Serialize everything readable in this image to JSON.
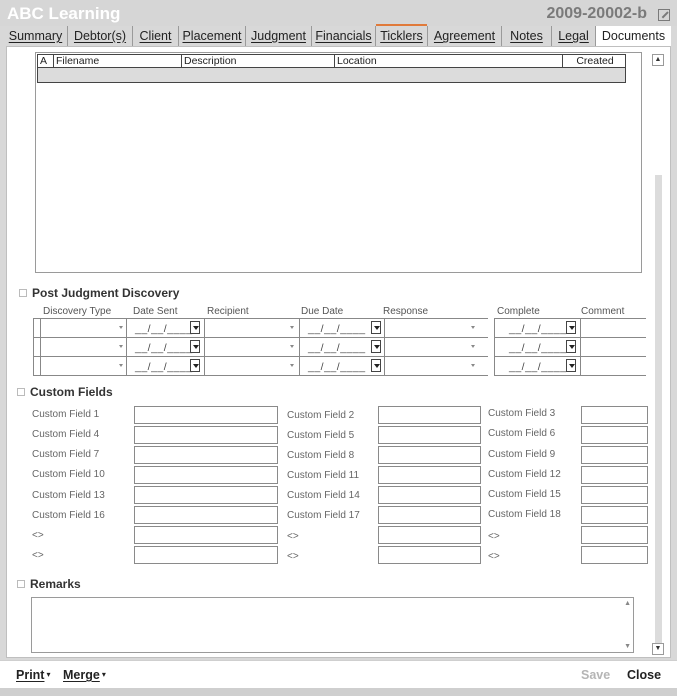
{
  "window": {
    "title": "ABC Learning",
    "case_number": "2009-20002-b",
    "popout_icon": "popout-icon"
  },
  "tabs": [
    {
      "label": "Summary",
      "active": false
    },
    {
      "label": "Debtor(s)",
      "active": false
    },
    {
      "label": "Client",
      "active": false
    },
    {
      "label": "Placement",
      "active": false
    },
    {
      "label": "Judgment",
      "active": false
    },
    {
      "label": "Financials",
      "active": false
    },
    {
      "label": "Ticklers",
      "active": false
    },
    {
      "label": "Agreement",
      "active": false
    },
    {
      "label": "Notes",
      "active": false
    },
    {
      "label": "Legal",
      "active": false
    },
    {
      "label": "Documents",
      "active": true
    }
  ],
  "documents": {
    "columns": [
      "A",
      "Filename",
      "Description",
      "Location",
      "Created"
    ]
  },
  "post_judgment": {
    "title": "Post Judgment Discovery",
    "columns": [
      "Discovery Type",
      "Date Sent",
      "Recipient",
      "Due Date",
      "Response",
      "Complete",
      "Comment"
    ],
    "rows": [
      {
        "date_sent": "__/__/____",
        "due_date": "__/__/____",
        "complete": "__/__/____"
      },
      {
        "date_sent": "__/__/____",
        "due_date": "__/__/____",
        "complete": "__/__/____"
      },
      {
        "date_sent": "__/__/____",
        "due_date": "__/__/____",
        "complete": "__/__/____"
      }
    ]
  },
  "custom_fields": {
    "title": "Custom Fields",
    "col1": [
      "Custom Field 1",
      "Custom Field 4",
      "Custom Field 7",
      "Custom Field 10",
      "Custom Field 13",
      "Custom Field 16",
      "<>",
      "<>"
    ],
    "col2": [
      "Custom Field 2",
      "Custom Field 5",
      "Custom Field 8",
      "Custom Field 11",
      "Custom Field 14",
      "Custom Field 17",
      "<>",
      "<>"
    ],
    "col3": [
      "Custom Field 3",
      "Custom Field 6",
      "Custom Field 9",
      "Custom Field 12",
      "Custom Field 15",
      "Custom Field 18",
      "<>",
      "<>"
    ]
  },
  "remarks": {
    "title": "Remarks",
    "value": ""
  },
  "footer": {
    "print_label": "Print",
    "merge_label": "Merge",
    "save_label": "Save",
    "close_label": "Close"
  },
  "colors": {
    "tab_accent": "#e07a3a",
    "title_text": "#ffffff",
    "case_text": "#7a7a7a"
  }
}
